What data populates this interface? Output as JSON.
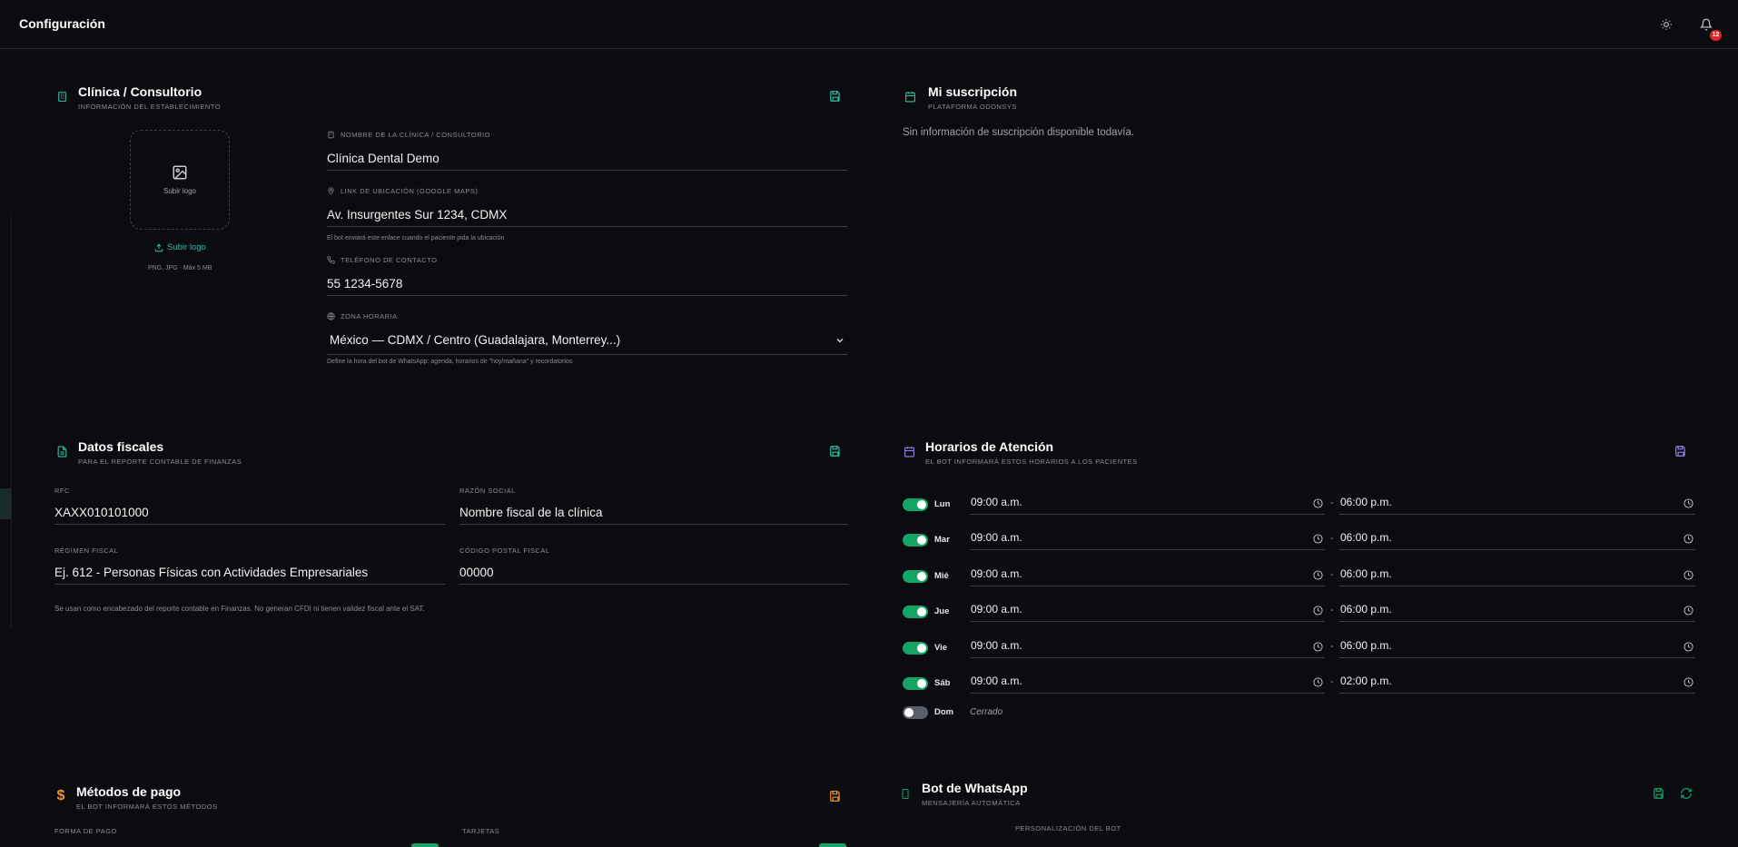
{
  "header": {
    "title": "Configuración",
    "notifications_count": "12",
    "theme_icon": "sun-icon",
    "bell_icon": "bell-icon"
  },
  "clinic": {
    "title": "Clínica / Consultorio",
    "subtitle": "INFORMACIÓN DEL ESTABLECIMIENTO",
    "logo_box_label": "Subir logo",
    "upload_link": "Subir logo",
    "upload_note": "PNG, JPG · Máx 5 MB",
    "name_label": "NOMBRE DE LA CLÍNICA / CONSULTORIO",
    "name_value": "Clínica Dental Demo",
    "location_label": "LINK DE UBICACIÓN (GOOGLE MAPS)",
    "location_value": "Av. Insurgentes Sur 1234, CDMX",
    "location_hint": "El bot enviará este enlace cuando el paciente pida la ubicación",
    "phone_label": "TELÉFONO DE CONTACTO",
    "phone_value": "55 1234-5678",
    "timezone_label": "ZONA HORARIA",
    "timezone_value": "México — CDMX / Centro (Guadalajara, Monterrey...)",
    "timezone_hint": "Define la hora del bot de WhatsApp: agenda, horarios de \"hoy/mañana\" y recordatorios"
  },
  "subscription": {
    "title": "Mi suscripción",
    "subtitle": "PLATAFORMA ODONSYS",
    "empty_text": "Sin información de suscripción disponible todavía."
  },
  "fiscal": {
    "title": "Datos fiscales",
    "subtitle": "PARA EL REPORTE CONTABLE DE FINANZAS",
    "rfc_label": "RFC",
    "rfc_value": "XAXX010101000",
    "razon_label": "RAZÓN SOCIAL",
    "razon_value": "Nombre fiscal de la clínica",
    "regimen_label": "RÉGIMEN FISCAL",
    "regimen_value": "Ej. 612 - Personas Físicas con Actividades Empresariales",
    "cp_label": "CÓDIGO POSTAL FISCAL",
    "cp_value": "00000",
    "note": "Se usan como encabezado del reporte contable en Finanzas. No generan CFDI ni tienen validez fiscal ante el SAT."
  },
  "hours": {
    "title": "Horarios de Atención",
    "subtitle": "EL BOT INFORMARÁ ESTOS HORARIOS A LOS PACIENTES",
    "separator": "-",
    "closed_label": "Cerrado",
    "days": [
      {
        "day": "Lun",
        "enabled": true,
        "open": "09:00 a.m.",
        "close": "06:00 p.m."
      },
      {
        "day": "Mar",
        "enabled": true,
        "open": "09:00 a.m.",
        "close": "06:00 p.m."
      },
      {
        "day": "Mié",
        "enabled": true,
        "open": "09:00 a.m.",
        "close": "06:00 p.m."
      },
      {
        "day": "Jue",
        "enabled": true,
        "open": "09:00 a.m.",
        "close": "06:00 p.m."
      },
      {
        "day": "Vie",
        "enabled": true,
        "open": "09:00 a.m.",
        "close": "06:00 p.m."
      },
      {
        "day": "Sáb",
        "enabled": true,
        "open": "09:00 a.m.",
        "close": "02:00 p.m."
      },
      {
        "day": "Dom",
        "enabled": false
      }
    ]
  },
  "payments": {
    "title": "Métodos de pago",
    "subtitle": "EL BOT INFORMARÁ ESTOS MÉTODOS",
    "col1_label": "FORMA DE PAGO",
    "col2_label": "TARJETAS"
  },
  "whatsapp": {
    "title": "Bot de WhatsApp",
    "subtitle": "MENSAJERÍA AUTOMÁTICA",
    "section_label": "PERSONALIZACIÓN DEL BOT"
  },
  "colors": {
    "teal": "#2fbfa8",
    "purple": "#9b7ff0",
    "orange": "#f0942e",
    "green": "#16a368",
    "badge": "#e02424"
  }
}
